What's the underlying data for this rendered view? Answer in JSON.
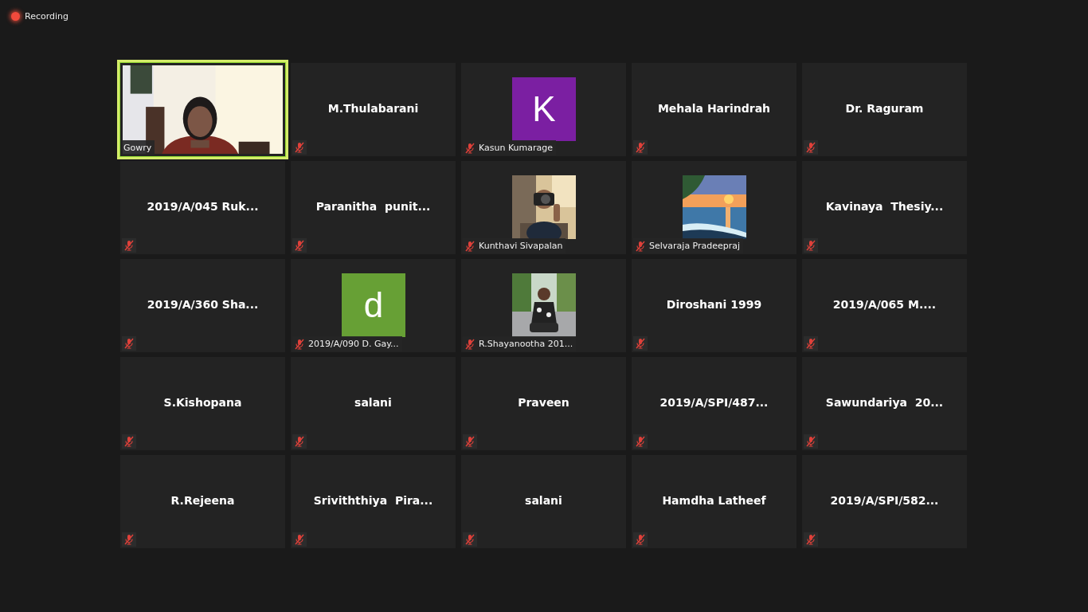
{
  "recording": {
    "label": "Recording"
  },
  "participants": [
    {
      "name": "Gowry",
      "kind": "video",
      "muted": false,
      "active_speaker": true
    },
    {
      "name": "M.Thulabarani",
      "kind": "name",
      "muted": true,
      "active_speaker": false
    },
    {
      "name": "Kasun Kumarage",
      "kind": "avatar",
      "initial": "K",
      "color": "#7b1fa2",
      "muted": true,
      "active_speaker": false
    },
    {
      "name": "Mehala Harindrah",
      "kind": "name",
      "muted": true,
      "active_speaker": false
    },
    {
      "name": "Dr. Raguram",
      "kind": "name",
      "muted": true,
      "active_speaker": false
    },
    {
      "name": "2019/A/045 Ruk...",
      "kind": "name",
      "muted": true,
      "active_speaker": false
    },
    {
      "name": "Paranitha  punit...",
      "kind": "name",
      "muted": true,
      "active_speaker": false
    },
    {
      "name": "Kunthavi Sivapalan",
      "muted": true,
      "active_speaker": false
    },
    {
      "name": "Selvaraja Pradeepraj",
      "muted": true,
      "active_speaker": false
    },
    {
      "name": "Kavinaya  Thesiy...",
      "kind": "name",
      "muted": true,
      "active_speaker": false
    },
    {
      "name": "2019/A/360 Sha...",
      "kind": "name",
      "muted": true,
      "active_speaker": false
    },
    {
      "name": "2019/A/090 D. Gay...",
      "kind": "avatar",
      "initial": "d",
      "color": "#67a035",
      "muted": true,
      "active_speaker": false
    },
    {
      "name": "R.Shayanootha 201...",
      "muted": true,
      "active_speaker": false
    },
    {
      "name": "Diroshani 1999",
      "kind": "name",
      "muted": true,
      "active_speaker": false
    },
    {
      "name": "2019/A/065 M....",
      "kind": "name",
      "muted": true,
      "active_speaker": false
    },
    {
      "name": "S.Kishopana",
      "kind": "name",
      "muted": true,
      "active_speaker": false
    },
    {
      "name": "salani",
      "kind": "name",
      "muted": true,
      "active_speaker": false
    },
    {
      "name": "Praveen",
      "kind": "name",
      "muted": true,
      "active_speaker": false
    },
    {
      "name": "2019/A/SPI/487...",
      "kind": "name",
      "muted": true,
      "active_speaker": false
    },
    {
      "name": "Sawundariya  20...",
      "kind": "name",
      "muted": true,
      "active_speaker": false
    },
    {
      "name": "R.Rejeena",
      "kind": "name",
      "muted": true,
      "active_speaker": false
    },
    {
      "name": "Sriviththiya  Pira...",
      "kind": "name",
      "muted": true,
      "active_speaker": false
    },
    {
      "name": "salani",
      "kind": "name",
      "muted": true,
      "active_speaker": false
    },
    {
      "name": "Hamdha Latheef",
      "kind": "name",
      "muted": true,
      "active_speaker": false
    },
    {
      "name": "2019/A/SPI/582...",
      "kind": "name",
      "muted": true,
      "active_speaker": false
    }
  ]
}
